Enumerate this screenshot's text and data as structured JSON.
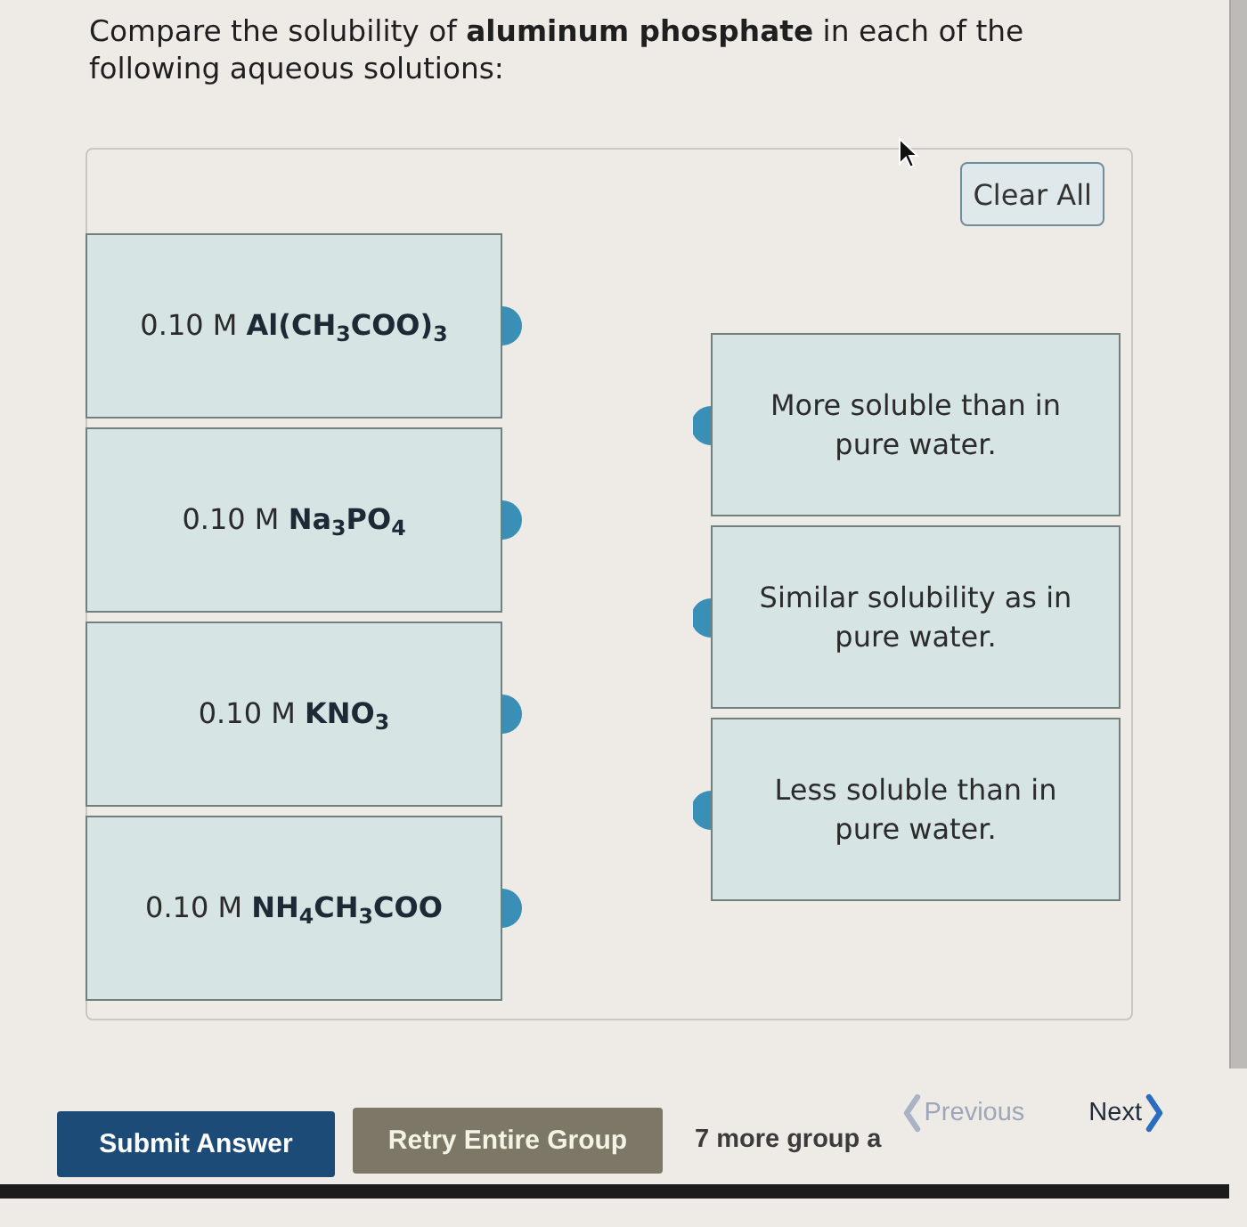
{
  "question": "Compare the solubility of **aluminum phosphate** in each of the following aqueous solutions:",
  "clear_button": "Clear All",
  "solutions": [
    {
      "concentration": "0.10 M",
      "formula": "Al(CH$_{3}$COO)$_{3}$"
    },
    {
      "concentration": "0.10 M",
      "formula": "Na$_{3}$PO$_{4}$"
    },
    {
      "concentration": "0.10 M",
      "formula": "KNO$_{3}$"
    },
    {
      "concentration": "0.10 M",
      "formula": "NH$_{4}$CH$_{3}$COO"
    }
  ],
  "categories": [
    "More soluble than in pure water.",
    "Similar solubility as in pure water.",
    "Less soluble than in pure water."
  ],
  "buttons": {
    "submit": "Submit Answer",
    "retry": "Retry Entire Group"
  },
  "more_groups": "7 more group a",
  "navigation": [
    {
      "kind": "previous",
      "label": "Previous",
      "disabled": true
    },
    {
      "kind": "next",
      "label": "Next",
      "disabled": false
    }
  ]
}
